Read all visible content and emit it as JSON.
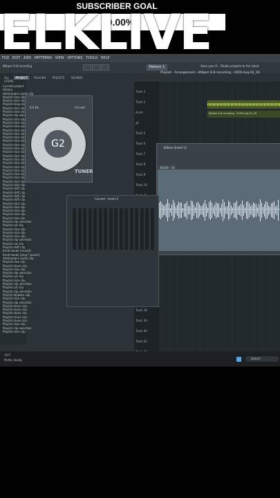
{
  "overlay": {
    "goal_label": "SUBSCRIBER GOAL",
    "goal_percent": "(0.00%",
    "big_text": "ELKLIVE"
  },
  "app": {
    "menu_items": [
      "FILE",
      "EDIT",
      "ADD",
      "PATTERNS",
      "VIEW",
      "OPTIONS",
      "TOOLS",
      "HELP"
    ],
    "project_subtitle": "80bpm 6-8 recording",
    "time_display": "0:20:83",
    "pattern_label": "Pattern 1",
    "arrangement_title": "Playlist - Arrangement › 80bpm 6-8 recording · 2026-Aug-02_16",
    "tip_text": "Save your fl... Studio projects to the cloud"
  },
  "browser": {
    "tabs": [
      "ALL",
      "PROJECT",
      "PLUGINS",
      "PRESETS",
      "SOUNDS",
      "STEMS"
    ],
    "active_tab": "PROJECT",
    "history_title": "History",
    "current_project": "Current project",
    "history_items": [
      "Add/replace audio clip",
      "Playlist slice clip",
      "Playlist slice clip",
      "Playlist drag clip",
      "Playlist slice clip",
      "Playlist slice clip",
      "Playlist clip selection",
      "Playlist slice clip",
      "Playlist slice clip",
      "Playlist slice clip",
      "Playlist slice clip",
      "Playlist slice clip",
      "Playlist slice clip",
      "Playlist slice clip",
      "Playlist slice clip",
      "Playlist slice clip",
      "Playlist slice clip",
      "Playlist slice clip",
      "Playlist slice clip",
      "Playlist slice clip",
      "Playlist slice clip",
      "Playlist slice clip",
      "Playlist slice clip",
      "Playlist slice clip",
      "Playlist slice clip",
      "Playlist slice clip",
      "Playlist shift clip",
      "Playlist shift clip",
      "Playlist shift clip",
      "Playlist shift clip",
      "Playlist slice clip",
      "Playlist slice clip",
      "Playlist slice clip",
      "Playlist slice clip",
      "Playlist slice clip",
      "Playlist clip selection",
      "Playlist cut clip",
      "Playlist slice clip",
      "Playlist slice clip",
      "Playlist slice clip",
      "Playlist clip selection",
      "Playlist cut clip",
      "Playlist shift clip",
      "Knob tweak (record)",
      "Knob tweak (plug * pause)",
      "Add/replace audio clip",
      "Playlist slice clip",
      "Playlist move clip",
      "Playlist slice clip",
      "Playlist clip selection",
      "Playlist cut clip",
      "Playlist slice clip",
      "Playlist clip selection",
      "Playlist cut clip",
      "Playlist clip selection",
      "Playlist doubles clip",
      "Playlist slice clip",
      "Playlist clip selection",
      "Playlist move clip",
      "Playlist move clip",
      "Playlist stone clip",
      "Playlist move clip",
      "Playlist move clip",
      "Playlist slice clip",
      "Playlist clip selection",
      "Playlist slice clip"
    ]
  },
  "tuner": {
    "note": "G2",
    "label": "TUNER",
    "left_value": "0.0 Hz",
    "right_value": "+0 cent"
  },
  "playlist": {
    "pattern_name": "Pattern 1",
    "tracks": [
      "Track 1",
      "Track 2",
      "drum",
      "g1",
      "Track 5",
      "Track 6",
      "Track 7",
      "Track 8",
      "Track 9",
      "Track 10",
      "Track 11",
      "Track 12",
      "Track 13"
    ],
    "bottom_tracks": [
      "Track 38",
      "Track 39",
      "Track 40",
      "Track 41",
      "Track 42"
    ],
    "clip_label": "80bpm 6-8 recording · 2026-Aug-02_16"
  },
  "edison": {
    "title": "Edison (Insert 1)",
    "format": "44100 · 16"
  },
  "mixer": {
    "title": "Current · Insert 1"
  },
  "taskbar": {
    "weather_temp": "74°F",
    "weather_desc": "Partly cloudy",
    "search_placeholder": "Search"
  }
}
